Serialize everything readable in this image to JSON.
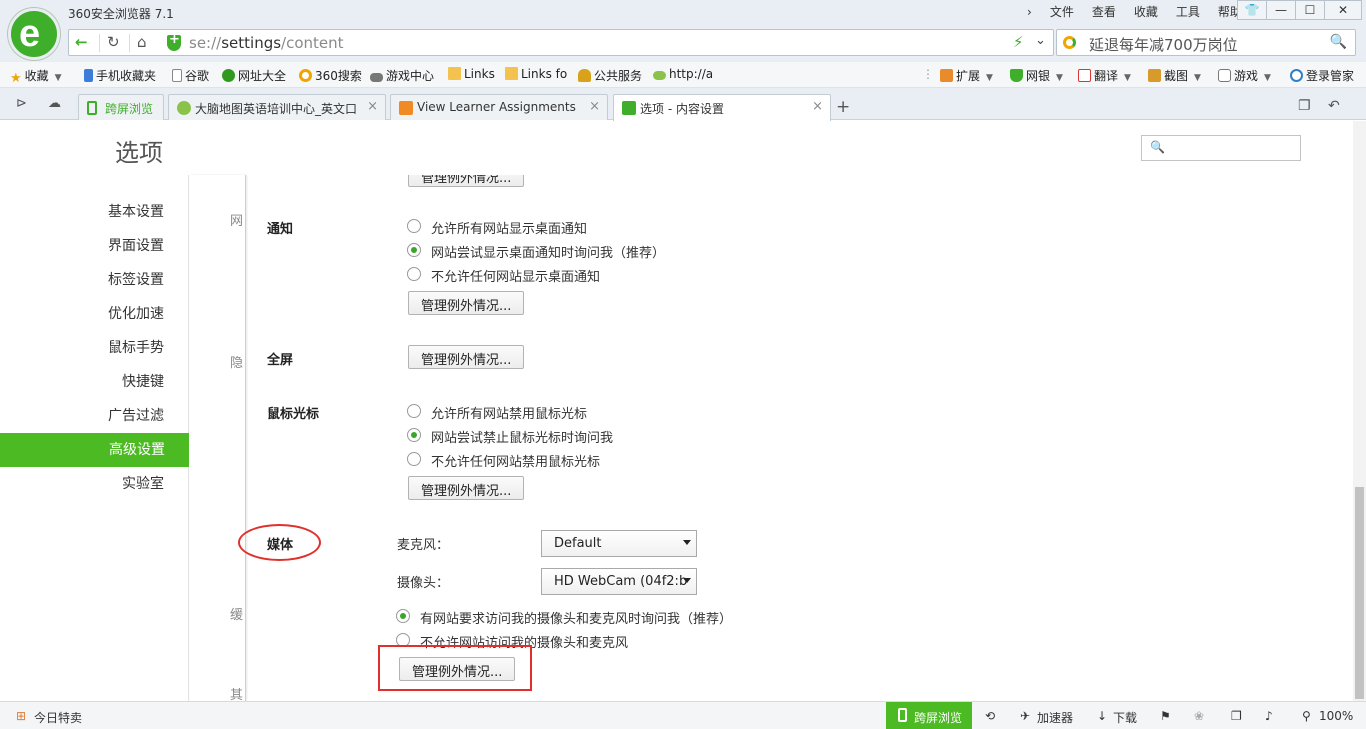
{
  "window": {
    "title": "360安全浏览器 7.1",
    "menu": [
      "文件",
      "查看",
      "收藏",
      "工具",
      "帮助"
    ],
    "controls": {
      "shirt": "👕",
      "minimize": "—",
      "maximize": "☐",
      "close": "✕"
    },
    "top_chevron": "›"
  },
  "address_bar": {
    "back": "←",
    "reload": "↻",
    "home": "⌂",
    "url_scheme": "se://",
    "url_host": "settings",
    "url_path": "/content",
    "bolt": "⚡",
    "dropdown": "⌄"
  },
  "search_bar": {
    "text": "延退每年减700万岗位",
    "icon": "search-icon",
    "mag": "🔍"
  },
  "bookmarks": {
    "left": [
      {
        "label": "收藏",
        "icon": "star-icon"
      },
      {
        "label": "手机收藏夹",
        "icon": "phone-icon"
      },
      {
        "label": "谷歌",
        "icon": "page-icon"
      },
      {
        "label": "网址大全",
        "icon": "plus-icon"
      },
      {
        "label": "360搜索",
        "icon": "360-icon"
      },
      {
        "label": "游戏中心",
        "icon": "gamepad-icon"
      },
      {
        "label": "Links",
        "icon": "folder-icon"
      },
      {
        "label": "Links fo",
        "icon": "folder-icon"
      },
      {
        "label": "公共服务",
        "icon": "bell-icon"
      },
      {
        "label": "http://a",
        "icon": "web-icon"
      }
    ],
    "right": [
      {
        "label": "扩展",
        "icon": "grid-icon"
      },
      {
        "label": "网银",
        "icon": "shield-icon"
      },
      {
        "label": "翻译",
        "icon": "translate-icon"
      },
      {
        "label": "截图",
        "icon": "scissors-icon"
      },
      {
        "label": "游戏",
        "icon": "gamepad-icon"
      },
      {
        "label": "登录管家",
        "icon": "login-icon"
      }
    ]
  },
  "tabs": {
    "items": [
      {
        "label": "跨屏浏览",
        "active": false
      },
      {
        "label": "大脑地图英语培训中心_英文口语",
        "active": false
      },
      {
        "label": "View Learner Assignments",
        "active": false
      },
      {
        "label": "选项 - 内容设置",
        "active": true
      }
    ],
    "close": "×",
    "new_tab": "+"
  },
  "page": {
    "title": "选项",
    "search_placeholder": "🔍"
  },
  "sidebar": {
    "items": [
      {
        "label": "基本设置"
      },
      {
        "label": "界面设置"
      },
      {
        "label": "标签设置"
      },
      {
        "label": "优化加速"
      },
      {
        "label": "鼠标手势"
      },
      {
        "label": "快捷键"
      },
      {
        "label": "广告过滤"
      },
      {
        "label": "高级设置",
        "active": true
      },
      {
        "label": "实验室"
      }
    ]
  },
  "gutter_labels": [
    "网",
    "隐",
    "缓",
    "其"
  ],
  "content": {
    "top_button": "管理例外情况...",
    "notification": {
      "title": "通知",
      "options": [
        "允许所有网站显示桌面通知",
        "网站尝试显示桌面通知时询问我（推荐）",
        "不允许任何网站显示桌面通知"
      ],
      "selected": 1,
      "button": "管理例外情况..."
    },
    "fullscreen": {
      "title": "全屏",
      "button": "管理例外情况..."
    },
    "mouse_cursor": {
      "title": "鼠标光标",
      "options": [
        "允许所有网站禁用鼠标光标",
        "网站尝试禁止鼠标光标时询问我",
        "不允许任何网站禁用鼠标光标"
      ],
      "selected": 1,
      "button": "管理例外情况..."
    },
    "media": {
      "title": "媒体",
      "microphone_label": "麦克风：",
      "microphone_value": "Default",
      "camera_label": "摄像头：",
      "camera_value": "HD WebCam (04f2:b",
      "options": [
        "有网站要求访问我的摄像头和麦克风时询问我（推荐）",
        "不允许网站访问我的摄像头和麦克风"
      ],
      "selected": 0,
      "button": "管理例外情况..."
    }
  },
  "annotations": {
    "colors": {
      "mark": "#e0302c"
    }
  },
  "statusbar": {
    "today_deals": "今日特卖",
    "cross_screen": "跨屏浏览",
    "accelerator": "加速器",
    "download": "下载",
    "zoom": "100%"
  },
  "colors": {
    "accent": "#4cbb23",
    "chrome": "#e8eef3"
  }
}
